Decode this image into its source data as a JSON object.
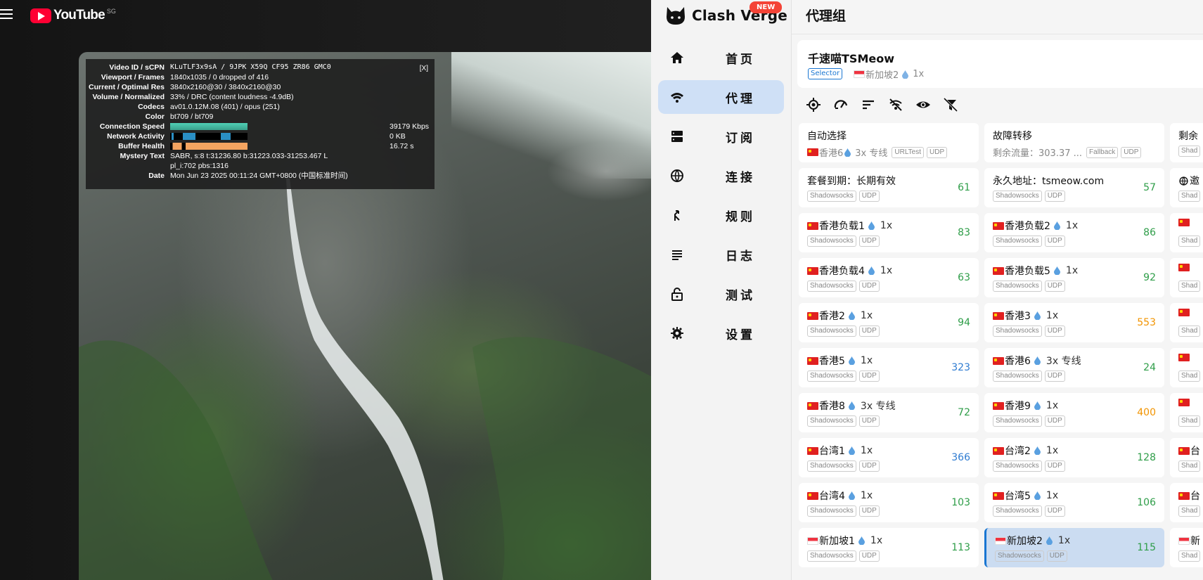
{
  "youtube": {
    "logo_text": "YouTube",
    "country_code": "SG",
    "stats": {
      "close": "[X]",
      "rows": [
        {
          "k": "Video ID / sCPN",
          "v": "KLuTLF3x9sA / 9JPK X59Q CF95 ZR86 GMC0",
          "mono": true
        },
        {
          "k": "Viewport / Frames",
          "v": "1840x1035 / 0 dropped of 416"
        },
        {
          "k": "Current / Optimal Res",
          "v": "3840x2160@30 / 3840x2160@30"
        },
        {
          "k": "Volume / Normalized",
          "v": "33% / DRC (content loudness -4.9dB)"
        },
        {
          "k": "Codecs",
          "v": "av01.0.12M.08 (401) / opus (251)"
        },
        {
          "k": "Color",
          "v": "bt709 / bt709"
        },
        {
          "k": "Connection Speed",
          "v": "",
          "bar": "conn",
          "right": "39179 Kbps"
        },
        {
          "k": "Network Activity",
          "v": "",
          "bar": "net",
          "right": "0 KB"
        },
        {
          "k": "Buffer Health",
          "v": "",
          "bar": "buf",
          "right": "16.72 s"
        },
        {
          "k": "Mystery Text",
          "v": "SABR, s:8 t:31236.80 b:31223.033-31253.467 L"
        },
        {
          "k": "",
          "v": "pl_i:702 pbs:1316"
        },
        {
          "k": "Date",
          "v": "Mon Jun 23 2025 00:11:24 GMT+0800 (中国标准时间)"
        }
      ]
    }
  },
  "clash": {
    "brand": "Clash Verge",
    "new_badge": "NEW",
    "nav": [
      {
        "label": "首页",
        "icon": "home-icon"
      },
      {
        "label": "代理",
        "icon": "wifi-icon",
        "active": true
      },
      {
        "label": "订阅",
        "icon": "storage-icon"
      },
      {
        "label": "连接",
        "icon": "globe-icon"
      },
      {
        "label": "规则",
        "icon": "fork-icon"
      },
      {
        "label": "日志",
        "icon": "list-icon"
      },
      {
        "label": "测试",
        "icon": "lock-icon"
      },
      {
        "label": "设置",
        "icon": "gear-icon"
      }
    ],
    "title": "代理组",
    "group": {
      "name": "千速喵TSMeow",
      "type": "Selector",
      "now": "新加坡2",
      "mult": "1x"
    },
    "toolbar": [
      "locate-icon",
      "speed-test-icon",
      "sort-icon",
      "no-latency-icon",
      "eye-icon",
      "filter-off-icon"
    ],
    "colors": {
      "accent": "#1976d2",
      "selected_bg": "#cbdcf1",
      "latency_good": "#2e9d48",
      "latency_mid": "#2e7bd1",
      "latency_bad": "#f29400"
    },
    "cards": [
      {
        "col": 0,
        "row": 0,
        "name": "自动选择",
        "sub_flag": "cn",
        "sub_text": "香港6",
        "sub_mult": "3x 专线",
        "chips": [
          "URLTest",
          "UDP"
        ],
        "latency": ""
      },
      {
        "col": 1,
        "row": 0,
        "name": "故障转移",
        "sub_text": "剩余流量：303.37 ...",
        "chips": [
          "Fallback",
          "UDP"
        ],
        "latency": ""
      },
      {
        "col": 2,
        "row": 0,
        "name": "剩余",
        "chips": [
          "Shad"
        ],
        "latency": ""
      },
      {
        "col": 0,
        "row": 1,
        "name": "套餐到期：长期有效",
        "chips": [
          "Shadowsocks",
          "UDP"
        ],
        "latency": "61",
        "lc": "g"
      },
      {
        "col": 1,
        "row": 1,
        "name": "永久地址：tsmeow.com",
        "chips": [
          "Shadowsocks",
          "UDP"
        ],
        "latency": "57",
        "lc": "g"
      },
      {
        "col": 2,
        "row": 1,
        "name": "邀",
        "globe": true,
        "chips": [
          "Shad"
        ],
        "latency": ""
      },
      {
        "col": 0,
        "row": 2,
        "flag": "cn",
        "name": "香港负载1",
        "mult": "1x",
        "chips": [
          "Shadowsocks",
          "UDP"
        ],
        "latency": "83",
        "lc": "g"
      },
      {
        "col": 1,
        "row": 2,
        "flag": "cn",
        "name": "香港负载2",
        "mult": "1x",
        "chips": [
          "Shadowsocks",
          "UDP"
        ],
        "latency": "86",
        "lc": "g"
      },
      {
        "col": 2,
        "row": 2,
        "flag": "cn",
        "name": "",
        "chips": [
          "Shad"
        ],
        "latency": ""
      },
      {
        "col": 0,
        "row": 3,
        "flag": "cn",
        "name": "香港负载4",
        "mult": "1x",
        "chips": [
          "Shadowsocks",
          "UDP"
        ],
        "latency": "63",
        "lc": "g"
      },
      {
        "col": 1,
        "row": 3,
        "flag": "cn",
        "name": "香港负载5",
        "mult": "1x",
        "chips": [
          "Shadowsocks",
          "UDP"
        ],
        "latency": "92",
        "lc": "g"
      },
      {
        "col": 2,
        "row": 3,
        "flag": "cn",
        "name": "",
        "chips": [
          "Shad"
        ],
        "latency": ""
      },
      {
        "col": 0,
        "row": 4,
        "flag": "cn",
        "name": "香港2",
        "mult": "1x",
        "chips": [
          "Shadowsocks",
          "UDP"
        ],
        "latency": "94",
        "lc": "g"
      },
      {
        "col": 1,
        "row": 4,
        "flag": "cn",
        "name": "香港3",
        "mult": "1x",
        "chips": [
          "Shadowsocks",
          "UDP"
        ],
        "latency": "553",
        "lc": "o"
      },
      {
        "col": 2,
        "row": 4,
        "flag": "cn",
        "name": "",
        "chips": [
          "Shad"
        ],
        "latency": ""
      },
      {
        "col": 0,
        "row": 5,
        "flag": "cn",
        "name": "香港5",
        "mult": "1x",
        "chips": [
          "Shadowsocks",
          "UDP"
        ],
        "latency": "323",
        "lc": "b"
      },
      {
        "col": 1,
        "row": 5,
        "flag": "cn",
        "name": "香港6",
        "mult": "3x 专线",
        "chips": [
          "Shadowsocks",
          "UDP"
        ],
        "latency": "24",
        "lc": "g"
      },
      {
        "col": 2,
        "row": 5,
        "flag": "cn",
        "name": "",
        "chips": [
          "Shad"
        ],
        "latency": ""
      },
      {
        "col": 0,
        "row": 6,
        "flag": "cn",
        "name": "香港8",
        "mult": "3x 专线",
        "chips": [
          "Shadowsocks",
          "UDP"
        ],
        "latency": "72",
        "lc": "g"
      },
      {
        "col": 1,
        "row": 6,
        "flag": "cn",
        "name": "香港9",
        "mult": "1x",
        "chips": [
          "Shadowsocks",
          "UDP"
        ],
        "latency": "400",
        "lc": "o"
      },
      {
        "col": 2,
        "row": 6,
        "flag": "cn",
        "name": "",
        "chips": [
          "Shad"
        ],
        "latency": ""
      },
      {
        "col": 0,
        "row": 7,
        "flag": "cn",
        "name": "台湾1",
        "mult": "1x",
        "chips": [
          "Shadowsocks",
          "UDP"
        ],
        "latency": "366",
        "lc": "b"
      },
      {
        "col": 1,
        "row": 7,
        "flag": "cn",
        "name": "台湾2",
        "mult": "1x",
        "chips": [
          "Shadowsocks",
          "UDP"
        ],
        "latency": "128",
        "lc": "g"
      },
      {
        "col": 2,
        "row": 7,
        "flag": "cn",
        "name": "台",
        "chips": [
          "Shad"
        ],
        "latency": ""
      },
      {
        "col": 0,
        "row": 8,
        "flag": "cn",
        "name": "台湾4",
        "mult": "1x",
        "chips": [
          "Shadowsocks",
          "UDP"
        ],
        "latency": "103",
        "lc": "g"
      },
      {
        "col": 1,
        "row": 8,
        "flag": "cn",
        "name": "台湾5",
        "mult": "1x",
        "chips": [
          "Shadowsocks",
          "UDP"
        ],
        "latency": "106",
        "lc": "g"
      },
      {
        "col": 2,
        "row": 8,
        "flag": "cn",
        "name": "台",
        "chips": [
          "Shad"
        ],
        "latency": ""
      },
      {
        "col": 0,
        "row": 9,
        "flag": "sg",
        "name": "新加坡1",
        "mult": "1x",
        "chips": [
          "Shadowsocks",
          "UDP"
        ],
        "latency": "113",
        "lc": "g"
      },
      {
        "col": 1,
        "row": 9,
        "flag": "sg",
        "name": "新加坡2",
        "mult": "1x",
        "chips": [
          "Shadowsocks",
          "UDP"
        ],
        "latency": "115",
        "lc": "g",
        "selected": true
      },
      {
        "col": 2,
        "row": 9,
        "flag": "sg",
        "name": "新",
        "chips": [
          "Shad"
        ],
        "latency": ""
      }
    ]
  }
}
